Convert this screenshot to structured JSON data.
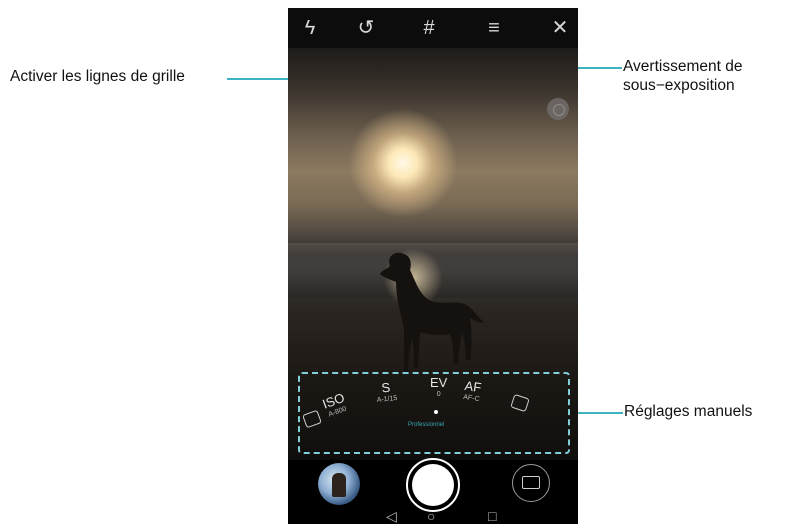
{
  "callouts": {
    "grid": "Activer les lignes de grille",
    "underexposure_line1": "Avertissement de",
    "underexposure_line2": "sous−exposition",
    "manual": "Réglages manuels"
  },
  "toolbar": {
    "flash_icon": "ϟ",
    "filter_icon": "↺",
    "grid_icon": "#",
    "menu_icon": "≡",
    "close_icon": "✕"
  },
  "manual_settings": [
    {
      "label": "ISO",
      "value": "A-800"
    },
    {
      "label": "S",
      "value": "A-1/15"
    },
    {
      "label": "EV",
      "value": "0"
    },
    {
      "label": "AF",
      "value": "AF-C"
    }
  ],
  "mode_label": "Professionnel",
  "nav": {
    "back": "◁",
    "home": "○",
    "recent": "□"
  },
  "colors": {
    "accent": "#3cb4c4"
  }
}
